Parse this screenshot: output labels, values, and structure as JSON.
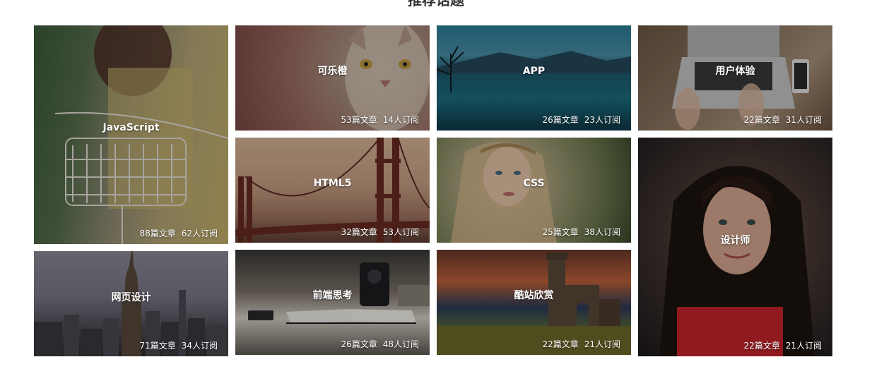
{
  "section": {
    "title": "推荐话题"
  },
  "tiles": [
    {
      "name": "JavaScript",
      "articles": "88篇文章",
      "subscribers": "62人订阅"
    },
    {
      "name": "可乐橙",
      "articles": "53篇文章",
      "subscribers": "14人订阅"
    },
    {
      "name": "APP",
      "articles": "26篇文章",
      "subscribers": "23人订阅"
    },
    {
      "name": "用户体验",
      "articles": "22篇文章",
      "subscribers": "31人订阅"
    },
    {
      "name": "HTML5",
      "articles": "32篇文章",
      "subscribers": "53人订阅"
    },
    {
      "name": "CSS",
      "articles": "25篇文章",
      "subscribers": "38人订阅"
    },
    {
      "name": "设计师",
      "articles": "22篇文章",
      "subscribers": "21人订阅"
    },
    {
      "name": "网页设计",
      "articles": "71篇文章",
      "subscribers": "34人订阅"
    },
    {
      "name": "前端思考",
      "articles": "26篇文章",
      "subscribers": "48人订阅"
    },
    {
      "name": "酷站欣赏",
      "articles": "22篇文章",
      "subscribers": "21人订阅"
    }
  ]
}
